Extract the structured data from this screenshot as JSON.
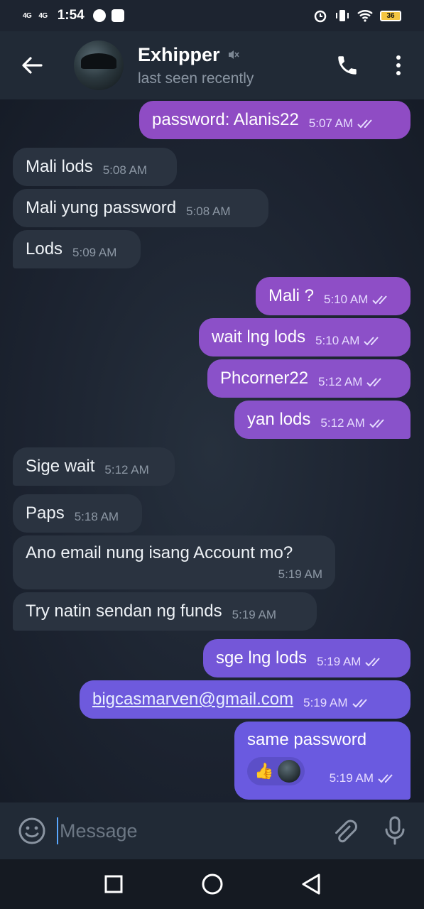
{
  "status_bar": {
    "signal1": "4G",
    "signal2": "4G",
    "time": "1:54",
    "battery": "36"
  },
  "header": {
    "contact_name": "Exhipper",
    "last_seen": "last seen recently"
  },
  "messages": [
    {
      "dir": "out",
      "text": "password: Alanis22",
      "time": "5:07 AM"
    },
    {
      "dir": "in",
      "text": "Mali lods",
      "time": "5:08 AM"
    },
    {
      "dir": "in",
      "text": "Mali yung password",
      "time": "5:08 AM"
    },
    {
      "dir": "in",
      "text": "Lods",
      "time": "5:09 AM"
    },
    {
      "dir": "out",
      "text": "Mali ?",
      "time": "5:10 AM"
    },
    {
      "dir": "out",
      "text": "wait lng lods",
      "time": "5:10 AM"
    },
    {
      "dir": "out",
      "text": "Phcorner22",
      "time": "5:12 AM"
    },
    {
      "dir": "out",
      "text": "yan lods",
      "time": "5:12 AM"
    },
    {
      "dir": "in",
      "text": "Sige wait",
      "time": "5:12 AM"
    },
    {
      "dir": "in",
      "text": "Paps",
      "time": "5:18 AM"
    },
    {
      "dir": "in",
      "text": "Ano email nung isang Account mo?",
      "time": "5:19 AM"
    },
    {
      "dir": "in",
      "text": "Try natin sendan ng funds",
      "time": "5:19 AM"
    },
    {
      "dir": "out",
      "text": "sge lng lods",
      "time": "5:19 AM"
    },
    {
      "dir": "out",
      "text": "bigcasmarven@gmail.com",
      "time": "5:19 AM"
    },
    {
      "dir": "out",
      "text": "same password",
      "time": "5:19 AM",
      "reaction": "👍"
    }
  ],
  "input": {
    "placeholder": "Message"
  },
  "colors": {
    "outgoing_top": "#9a4cc2",
    "outgoing_bottom": "#6a5ae0",
    "incoming": "#2a3340",
    "header": "#212a36"
  },
  "icons": {
    "back": "arrow-left-icon",
    "mute": "muted-speaker-icon",
    "call": "phone-icon",
    "more": "more-vertical-icon",
    "emoji": "smile-icon",
    "attach": "paperclip-icon",
    "mic": "microphone-icon"
  }
}
